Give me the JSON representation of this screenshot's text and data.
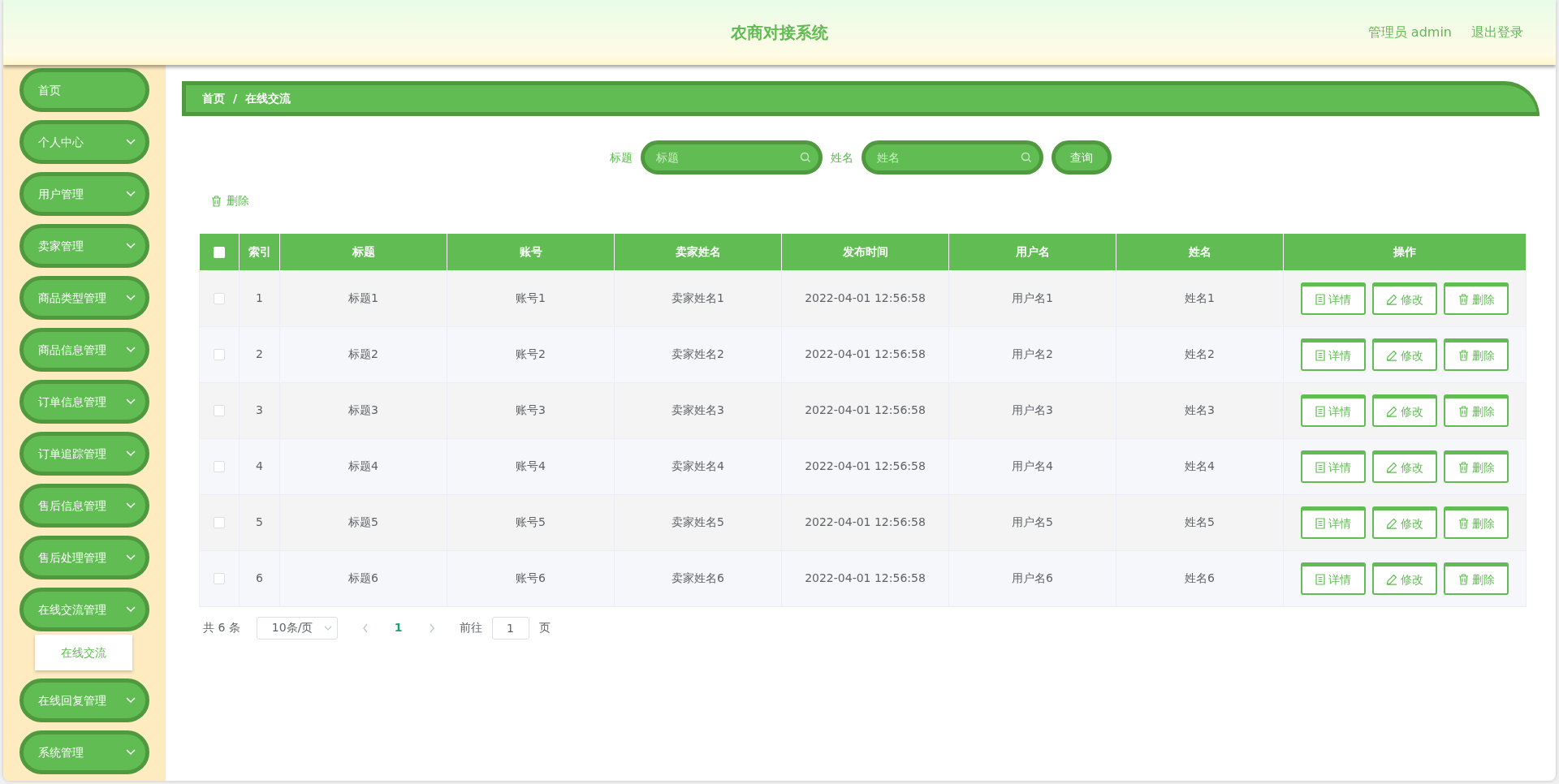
{
  "header": {
    "title": "农商对接系统",
    "user": "管理员 admin",
    "logout": "退出登录"
  },
  "sidebar": {
    "items": [
      {
        "label": "首页",
        "kind": "link"
      },
      {
        "label": "个人中心",
        "kind": "menu"
      },
      {
        "label": "用户管理",
        "kind": "menu"
      },
      {
        "label": "卖家管理",
        "kind": "menu"
      },
      {
        "label": "商品类型管理",
        "kind": "menu"
      },
      {
        "label": "商品信息管理",
        "kind": "menu"
      },
      {
        "label": "订单信息管理",
        "kind": "menu"
      },
      {
        "label": "订单追踪管理",
        "kind": "menu"
      },
      {
        "label": "售后信息管理",
        "kind": "menu"
      },
      {
        "label": "售后处理管理",
        "kind": "menu"
      },
      {
        "label": "在线交流管理",
        "kind": "menu",
        "children": [
          {
            "label": "在线交流"
          }
        ]
      },
      {
        "label": "在线回复管理",
        "kind": "menu"
      },
      {
        "label": "系统管理",
        "kind": "menu"
      }
    ]
  },
  "breadcrumb": {
    "items": [
      "首页",
      "在线交流"
    ],
    "separator": "/"
  },
  "search": {
    "fields": [
      {
        "label": "标题",
        "placeholder": "标题"
      },
      {
        "label": "姓名",
        "placeholder": "姓名"
      }
    ],
    "button": "查询"
  },
  "toolbar": {
    "delete": "删除"
  },
  "table": {
    "select_all_checked": false,
    "columns": [
      "索引",
      "标题",
      "账号",
      "卖家姓名",
      "发布时间",
      "用户名",
      "姓名",
      "操作"
    ],
    "rows": [
      {
        "selected": false,
        "cells": [
          "1",
          "标题1",
          "账号1",
          "卖家姓名1",
          "2022-04-01 12:56:58",
          "用户名1",
          "姓名1"
        ],
        "actions": [
          {
            "kind": "detail",
            "label": "详情"
          },
          {
            "kind": "edit",
            "label": "修改"
          },
          {
            "kind": "delete",
            "label": "删除"
          }
        ]
      },
      {
        "selected": false,
        "cells": [
          "2",
          "标题2",
          "账号2",
          "卖家姓名2",
          "2022-04-01 12:56:58",
          "用户名2",
          "姓名2"
        ],
        "actions": [
          {
            "kind": "detail",
            "label": "详情"
          },
          {
            "kind": "edit",
            "label": "修改"
          },
          {
            "kind": "delete",
            "label": "删除"
          }
        ]
      },
      {
        "selected": false,
        "cells": [
          "3",
          "标题3",
          "账号3",
          "卖家姓名3",
          "2022-04-01 12:56:58",
          "用户名3",
          "姓名3"
        ],
        "actions": [
          {
            "kind": "detail",
            "label": "详情"
          },
          {
            "kind": "edit",
            "label": "修改"
          },
          {
            "kind": "delete",
            "label": "删除"
          }
        ]
      },
      {
        "selected": false,
        "cells": [
          "4",
          "标题4",
          "账号4",
          "卖家姓名4",
          "2022-04-01 12:56:58",
          "用户名4",
          "姓名4"
        ],
        "actions": [
          {
            "kind": "detail",
            "label": "详情"
          },
          {
            "kind": "edit",
            "label": "修改"
          },
          {
            "kind": "delete",
            "label": "删除"
          }
        ]
      },
      {
        "selected": false,
        "cells": [
          "5",
          "标题5",
          "账号5",
          "卖家姓名5",
          "2022-04-01 12:56:58",
          "用户名5",
          "姓名5"
        ],
        "actions": [
          {
            "kind": "detail",
            "label": "详情"
          },
          {
            "kind": "edit",
            "label": "修改"
          },
          {
            "kind": "delete",
            "label": "删除"
          }
        ]
      },
      {
        "selected": false,
        "cells": [
          "6",
          "标题6",
          "账号6",
          "卖家姓名6",
          "2022-04-01 12:56:58",
          "用户名6",
          "姓名6"
        ],
        "actions": [
          {
            "kind": "detail",
            "label": "详情"
          },
          {
            "kind": "edit",
            "label": "修改"
          },
          {
            "kind": "delete",
            "label": "删除"
          }
        ]
      }
    ]
  },
  "pagination": {
    "total": "共 6 条",
    "page_size": "10条/页",
    "pages": [
      {
        "label": "1",
        "selected": true
      }
    ],
    "goto_label": "前往",
    "goto_value": "1",
    "goto_suffix": "页"
  }
}
